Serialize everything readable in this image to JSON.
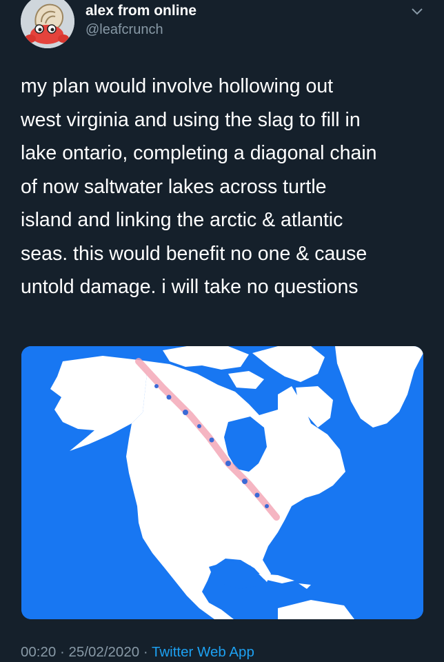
{
  "tweet": {
    "author": {
      "display_name": "alex from online",
      "handle": "@leafcrunch",
      "avatar_icon": "hermit-crab-avatar"
    },
    "menu_icon": "chevron-down-icon",
    "text_lines": [
      "my plan would involve hollowing out",
      "west virginia and using the slag to fill in",
      "lake ontario, completing a diagonal chain",
      "of now saltwater lakes across turtle",
      "island and linking the arctic & atlantic",
      "seas. this would benefit no one & cause",
      "untold damage. i will take no questions"
    ],
    "media": {
      "kind": "map-image",
      "description_icon": "north-america-map"
    },
    "timestamp": "00:20 · 25/02/2020 · ",
    "source": "Twitter Web App"
  },
  "colors": {
    "background": "#15202b",
    "text": "#ffffff",
    "secondary": "#8899a6",
    "link": "#1da1f2",
    "map_ocean": "#1877f2",
    "map_land": "#ffffff",
    "map_line": "#f2a3b3"
  }
}
